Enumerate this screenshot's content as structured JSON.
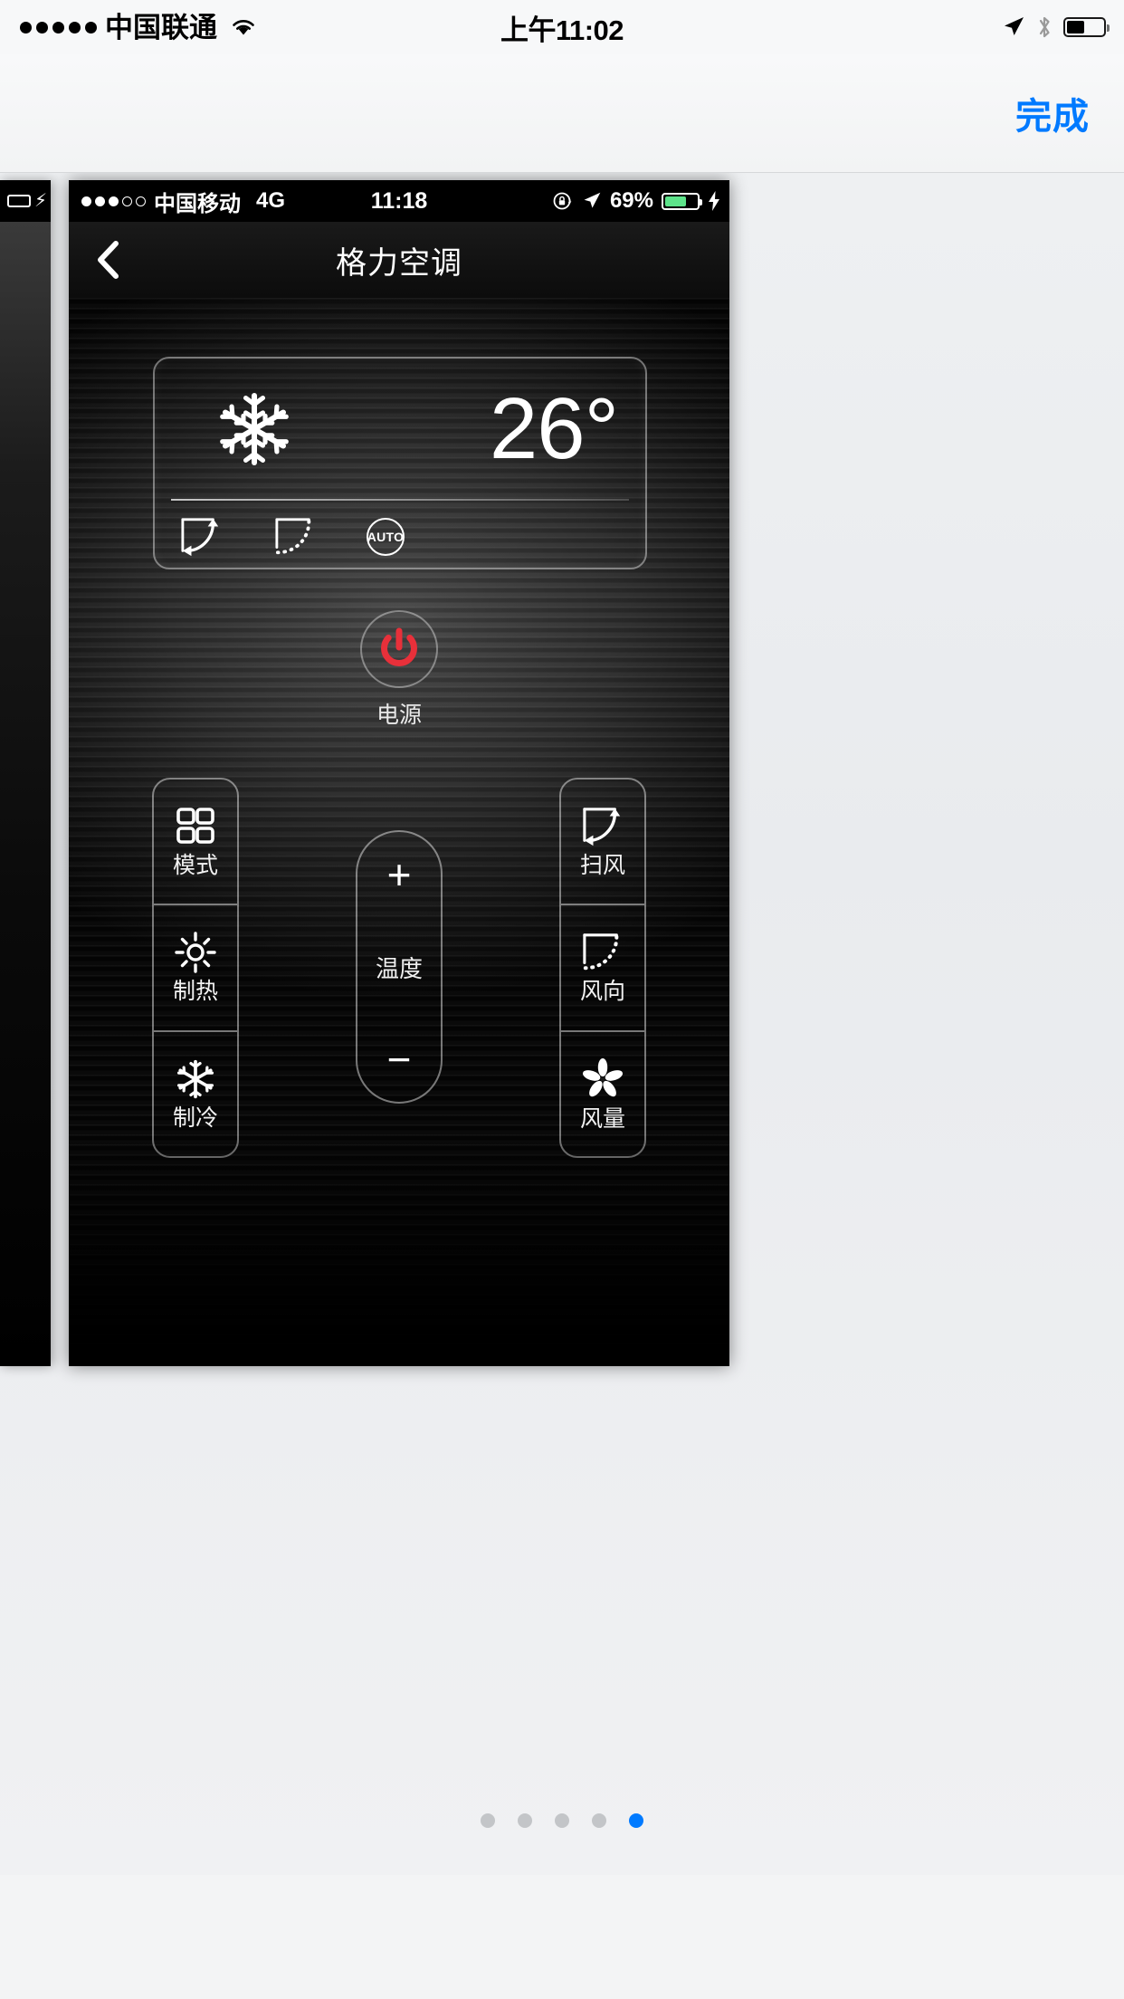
{
  "host_status_bar": {
    "signal_dots_filled": 5,
    "signal_dots_total": 5,
    "carrier": "中国联通",
    "wifi_icon": "wifi-icon",
    "time": "上午11:02",
    "location_icon": "location-arrow-icon",
    "bluetooth_icon": "bluetooth-icon",
    "battery_icon": "battery-icon"
  },
  "host_toolbar": {
    "done_label": "完成",
    "accent_color": "#007aff"
  },
  "phone_card": {
    "status_bar": {
      "signal_dots_filled": 3,
      "signal_dots_total": 5,
      "carrier": "中国移动",
      "network": "4G",
      "time": "11:18",
      "rotation_lock_icon": "rotation-lock-icon",
      "location_icon": "location-arrow-icon",
      "battery_percent": "69%",
      "battery_fill_color": "#5de38a",
      "charging_icon": "lightning-bolt-icon"
    },
    "nav_bar": {
      "back_icon": "chevron-left-icon",
      "title": "格力空调"
    },
    "display_panel": {
      "mode_icon": "snowflake-icon",
      "temperature": "26°",
      "indicators": [
        {
          "icon": "swing-arrow-icon",
          "name": "swing-indicator"
        },
        {
          "icon": "wind-direction-dashed-icon",
          "name": "wind-direction-indicator"
        },
        {
          "icon": "auto-badge-icon",
          "label": "AUTO"
        }
      ]
    },
    "power": {
      "icon": "power-icon",
      "label": "电源",
      "color": "#e8303a"
    },
    "left_column": [
      {
        "icon": "grid-four-squares-icon",
        "label": "模式"
      },
      {
        "icon": "sun-icon",
        "label": "制热"
      },
      {
        "icon": "snowflake-icon",
        "label": "制冷"
      }
    ],
    "temperature_control": {
      "increase_label": "+",
      "label": "温度",
      "decrease_label": "−"
    },
    "right_column": [
      {
        "icon": "swing-arrow-icon",
        "label": "扫风"
      },
      {
        "icon": "wind-direction-dashed-icon",
        "label": "风向"
      },
      {
        "icon": "fan-blades-icon",
        "label": "风量"
      }
    ]
  },
  "pagination": {
    "total": 5,
    "active_index": 4
  }
}
